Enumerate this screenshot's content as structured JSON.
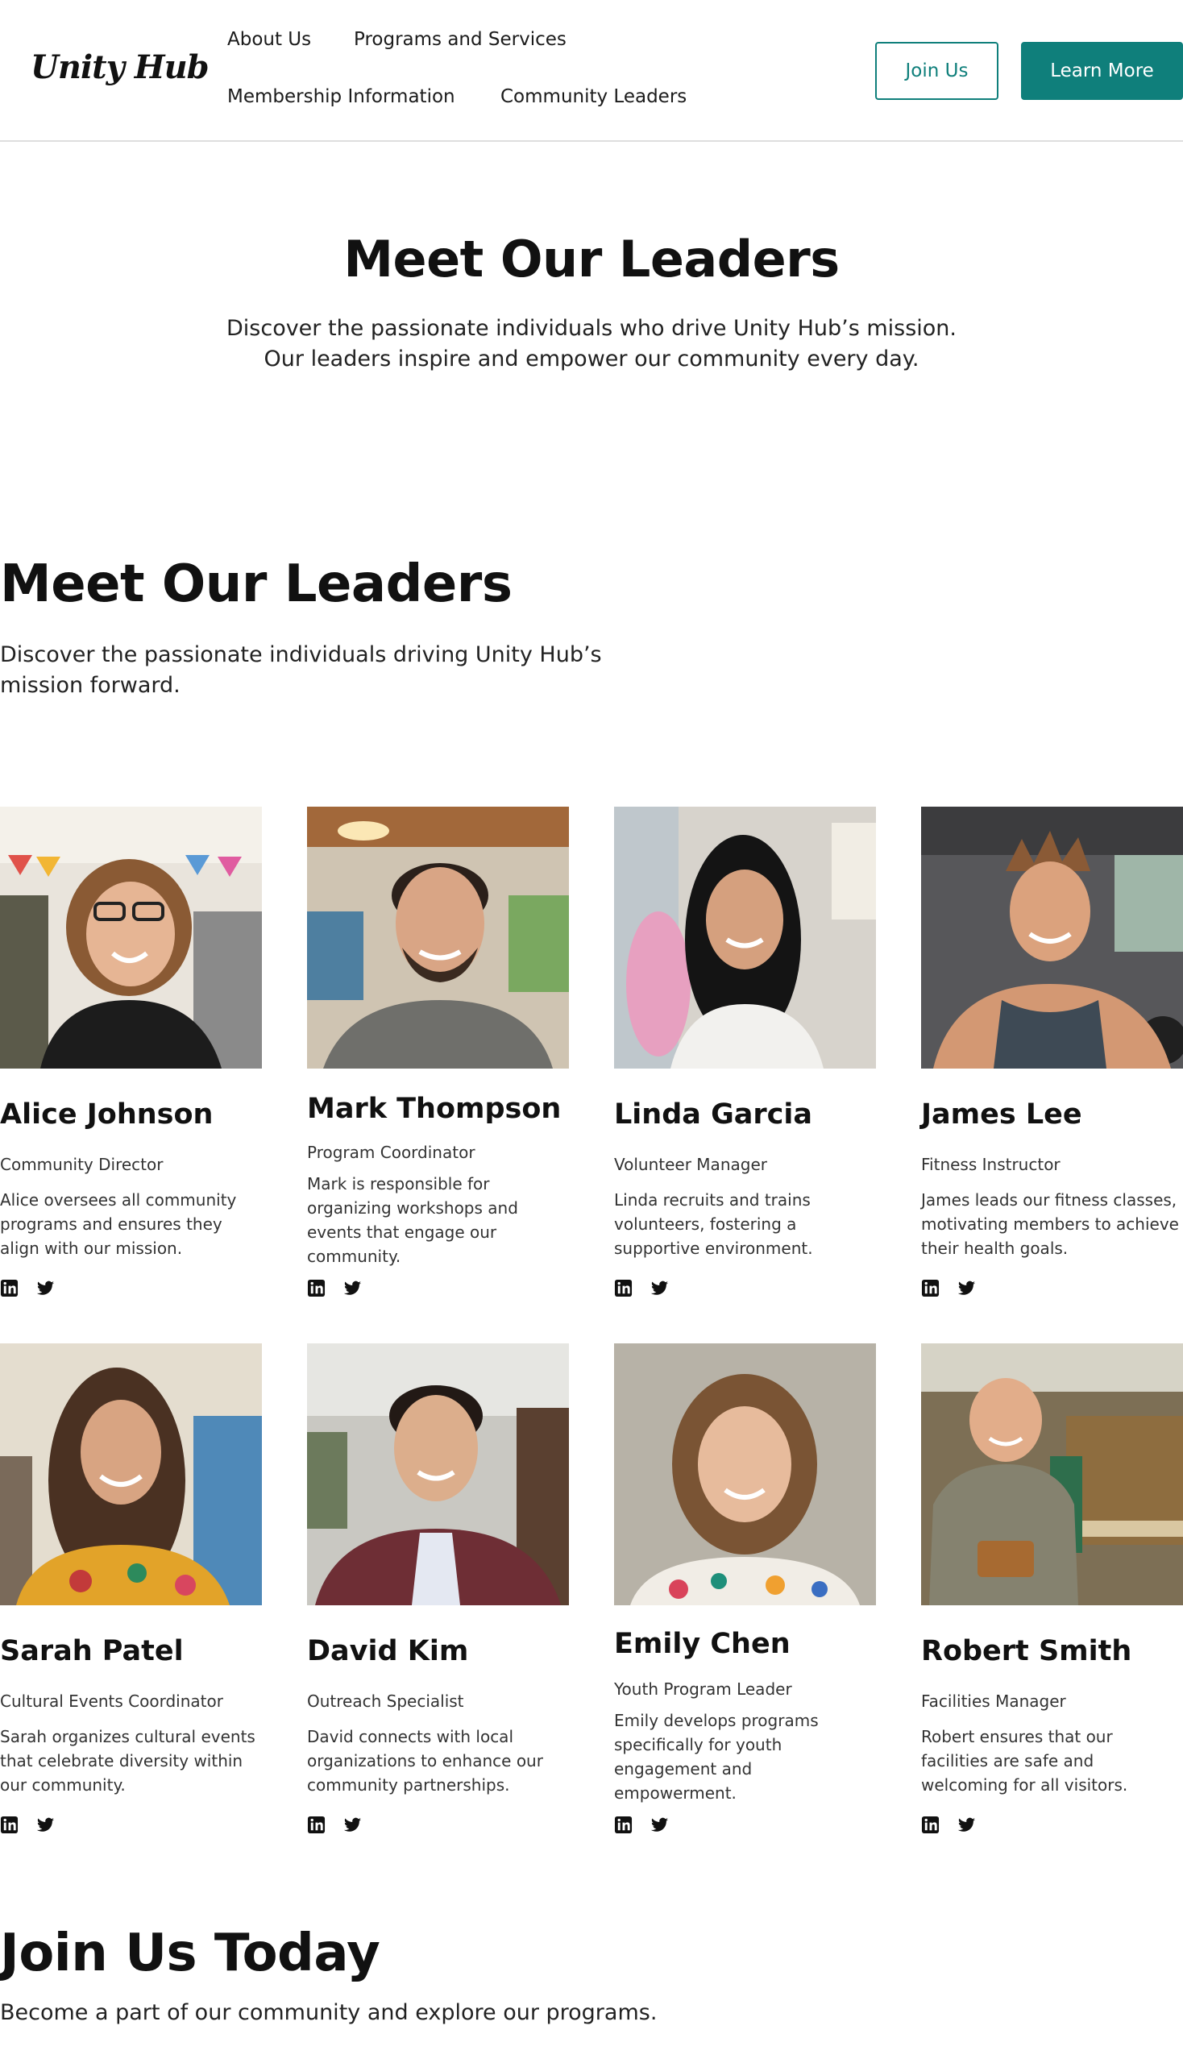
{
  "brand": {
    "name": "Unity Hub",
    "accent": "#0f7f7b"
  },
  "nav": {
    "about": "About Us",
    "programs": "Programs and Services",
    "membership": "Membership Information",
    "leaders": "Community Leaders"
  },
  "header_buttons": {
    "join": "Join Us",
    "learn_more": "Learn More"
  },
  "hero": {
    "title": "Meet Our Leaders",
    "subtitle_line1": "Discover the passionate individuals who drive Unity Hub’s mission.",
    "subtitle_line2": "Our leaders inspire and empower our community every day."
  },
  "leaders_section": {
    "title": "Meet Our Leaders",
    "subtitle": "Discover the passionate individuals driving Unity Hub’s mission forward."
  },
  "leaders": [
    {
      "name": "Alice Johnson",
      "role": "Community Director",
      "description": "Alice oversees all community programs and ensures they align with our mission."
    },
    {
      "name": "Mark Thompson",
      "role": "Program Coordinator",
      "description": "Mark is responsible for organizing workshops and events that engage our community."
    },
    {
      "name": "Linda Garcia",
      "role": "Volunteer Manager",
      "description": "Linda recruits and trains volunteers, fostering a supportive environment."
    },
    {
      "name": "James Lee",
      "role": "Fitness Instructor",
      "description": "James leads our fitness classes, motivating members to achieve their health goals."
    },
    {
      "name": "Sarah Patel",
      "role": "Cultural Events Coordinator",
      "description": "Sarah organizes cultural events that celebrate diversity within our community."
    },
    {
      "name": "David Kim",
      "role": "Outreach Specialist",
      "description": "David connects with local organizations to enhance our community partnerships."
    },
    {
      "name": "Emily Chen",
      "role": "Youth Program Leader",
      "description": "Emily develops programs specifically for youth engagement and empowerment."
    },
    {
      "name": "Robert Smith",
      "role": "Facilities Manager",
      "description": "Robert ensures that our facilities are safe and welcoming for all visitors."
    }
  ],
  "social_icons": [
    "linkedin-icon",
    "twitter-icon"
  ],
  "join": {
    "title": "Join Us Today",
    "subtitle": "Become a part of our community and explore our programs."
  }
}
